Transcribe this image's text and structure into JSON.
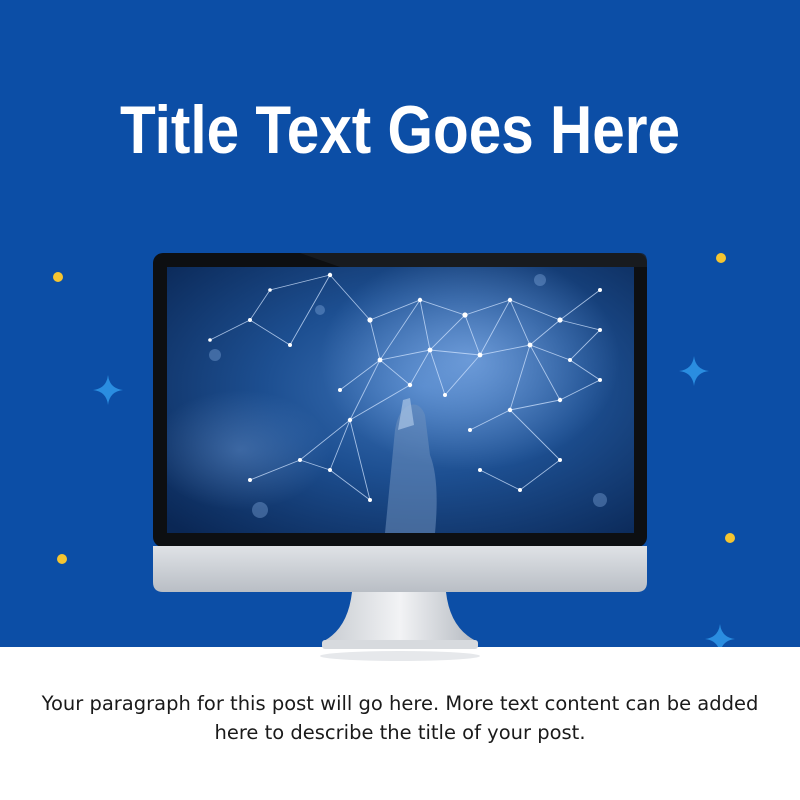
{
  "post": {
    "title": "Title Text Goes Here",
    "paragraph": "Your paragraph for this post will go here. More text content can be added here to describe the title of your post."
  },
  "colors": {
    "background_blue": "#0c4ea6",
    "dot_yellow": "#f5c531",
    "sparkle_blue": "#2a8de0",
    "text_dark": "#1a1a1a"
  },
  "icons": [
    "monitor-illustration",
    "sparkle-icon",
    "dot-icon"
  ]
}
